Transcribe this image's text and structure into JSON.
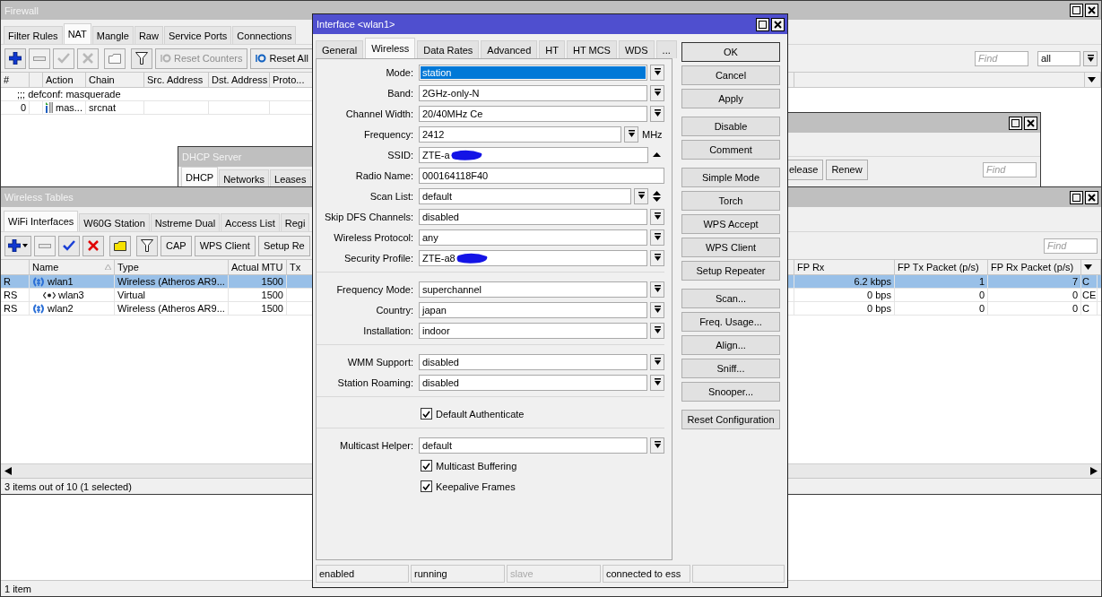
{
  "firewall": {
    "title": "Firewall",
    "tabs": [
      {
        "label": "Filter Rules",
        "selected": false
      },
      {
        "label": "NAT",
        "selected": true
      },
      {
        "label": "Mangle",
        "selected": false
      },
      {
        "label": "Raw",
        "selected": false
      },
      {
        "label": "Service Ports",
        "selected": false
      },
      {
        "label": "Connections",
        "selected": false
      }
    ],
    "toolbar": [
      {
        "kind": "add",
        "disabled": false
      },
      {
        "kind": "remove",
        "disabled": true
      },
      {
        "kind": "enable",
        "disabled": true
      },
      {
        "kind": "disable",
        "disabled": true
      },
      {
        "kind": "comment",
        "disabled": true
      },
      {
        "kind": "filter",
        "disabled": false
      },
      {
        "kind": "reset",
        "label": "Reset Counters",
        "disabled": true
      },
      {
        "kind": "reset",
        "label": "Reset All",
        "disabled": false
      }
    ],
    "find": {
      "placeholder": "Find"
    },
    "scope": "all",
    "columns": [
      "#",
      "Action",
      "Chain",
      "Src. Address",
      "Dst. Address",
      "Proto..."
    ],
    "rows": [
      {
        "kind": "comment",
        "text": ";;; defconf: masquerade"
      },
      {
        "kind": "rule",
        "number": "0",
        "action": "mas...",
        "chain": "srcnat"
      }
    ],
    "status": "1 item"
  },
  "dhcp_server": {
    "title": "DHCP Server",
    "tabs": [
      {
        "label": "DHCP",
        "selected": true
      },
      {
        "label": "Networks",
        "selected": false
      },
      {
        "label": "Leases",
        "selected": false
      }
    ]
  },
  "dhcp_client": {
    "buttons": [
      "elease",
      "Renew"
    ],
    "find": {
      "placeholder": "Find"
    }
  },
  "wireless_tables": {
    "title": "Wireless Tables",
    "tabs": [
      {
        "label": "WiFi Interfaces",
        "selected": true
      },
      {
        "label": "W60G Station",
        "selected": false
      },
      {
        "label": "Nstreme Dual",
        "selected": false
      },
      {
        "label": "Access List",
        "selected": false
      },
      {
        "label": "Regi",
        "selected": false
      }
    ],
    "toolbar": [
      {
        "kind": "add_menu",
        "disabled": false
      },
      {
        "kind": "remove",
        "disabled": true
      },
      {
        "kind": "enable",
        "disabled": false
      },
      {
        "kind": "disable",
        "disabled": false
      },
      {
        "kind": "comment",
        "disabled": false
      },
      {
        "kind": "filter",
        "disabled": false
      },
      {
        "kind": "text",
        "label": "CAP",
        "disabled": false
      },
      {
        "kind": "text",
        "label": "WPS Client",
        "disabled": false
      },
      {
        "kind": "text",
        "label": "Setup Re",
        "disabled": false
      }
    ],
    "find": {
      "placeholder": "Find"
    },
    "columns": [
      "Name",
      "Type",
      "Actual MTU",
      "Tx"
    ],
    "right_columns": [
      "FP Rx",
      "FP Tx Packet (p/s)",
      "FP Rx Packet (p/s)"
    ],
    "rows": [
      {
        "flags": "R",
        "name": "wlan1",
        "kind": "wireless",
        "type": "Wireless (Atheros AR9...",
        "mtu": "1500",
        "fp_rx": "6.2 kbps",
        "fp_tx_packet": "1",
        "fp_rx_packet": "7",
        "column_last": "C",
        "selected": true,
        "children": [
          {
            "flags": "RS",
            "name": "wlan3",
            "kind": "virtual",
            "type": "Virtual",
            "mtu": "1500",
            "fp_rx": "0 bps",
            "fp_tx_packet": "0",
            "fp_rx_packet": "0",
            "column_last": "CE",
            "selected": false
          }
        ]
      },
      {
        "flags": "RS",
        "name": "wlan2",
        "kind": "wireless",
        "type": "Wireless (Atheros AR9...",
        "mtu": "1500",
        "fp_rx": "0 bps",
        "fp_tx_packet": "0",
        "fp_rx_packet": "0",
        "column_last": "C",
        "selected": false
      }
    ],
    "status": "3 items out of 10 (1 selected)"
  },
  "interface_dialog": {
    "title": "Interface <wlan1>",
    "tabs": [
      {
        "label": "General",
        "selected": false
      },
      {
        "label": "Wireless",
        "selected": true
      },
      {
        "label": "Data Rates",
        "selected": false
      },
      {
        "label": "Advanced",
        "selected": false
      },
      {
        "label": "HT",
        "selected": false
      },
      {
        "label": "HT MCS",
        "selected": false
      },
      {
        "label": "WDS",
        "selected": false
      },
      {
        "label": "...",
        "selected": false
      }
    ],
    "fields": [
      {
        "kind": "combo",
        "label": "Mode:",
        "value": "station",
        "highlighted": true,
        "redacted": false
      },
      {
        "kind": "combo",
        "label": "Band:",
        "value": "2GHz-only-N",
        "highlighted": false,
        "redacted": false
      },
      {
        "kind": "combo",
        "label": "Channel Width:",
        "value": "20/40MHz Ce",
        "highlighted": false,
        "redacted": false
      },
      {
        "kind": "combo",
        "label": "Frequency:",
        "value": "2412",
        "unit": "MHz",
        "highlighted": false,
        "redacted": false
      },
      {
        "kind": "collapsible",
        "label": "SSID:",
        "value": "ZTE-a",
        "highlighted": false,
        "redacted": true
      },
      {
        "kind": "text",
        "label": "Radio Name:",
        "value": "000164118F40",
        "highlighted": false,
        "redacted": false
      },
      {
        "kind": "multiselect",
        "label": "Scan List:",
        "value": "default",
        "highlighted": false,
        "redacted": false
      },
      {
        "kind": "combo",
        "label": "Skip DFS Channels:",
        "value": "disabled",
        "highlighted": false,
        "redacted": false
      },
      {
        "kind": "combo",
        "label": "Wireless Protocol:",
        "value": "any",
        "highlighted": false,
        "redacted": false
      },
      {
        "kind": "combo",
        "label": "Security Profile:",
        "value": "ZTE-a8",
        "highlighted": false,
        "redacted": true
      },
      {
        "kind": "separator"
      },
      {
        "kind": "combo",
        "label": "Frequency Mode:",
        "value": "superchannel",
        "highlighted": false,
        "redacted": false
      },
      {
        "kind": "combo",
        "label": "Country:",
        "value": "japan",
        "highlighted": false,
        "redacted": false
      },
      {
        "kind": "combo",
        "label": "Installation:",
        "value": "indoor",
        "highlighted": false,
        "redacted": false
      },
      {
        "kind": "separator"
      },
      {
        "kind": "combo",
        "label": "WMM Support:",
        "value": "disabled",
        "highlighted": false,
        "redacted": false
      },
      {
        "kind": "combo",
        "label": "Station Roaming:",
        "value": "disabled",
        "highlighted": false,
        "redacted": false
      },
      {
        "kind": "separator"
      },
      {
        "kind": "checkbox",
        "label": "Default Authenticate",
        "checked": true
      },
      {
        "kind": "separator"
      },
      {
        "kind": "combo",
        "label": "Multicast Helper:",
        "value": "default",
        "highlighted": false,
        "redacted": false
      },
      {
        "kind": "checkbox",
        "label": "Multicast Buffering",
        "checked": true
      },
      {
        "kind": "checkbox",
        "label": "Keepalive Frames",
        "checked": true
      }
    ],
    "button_groups": [
      [
        {
          "label": "OK",
          "default": true
        },
        {
          "label": "Cancel",
          "default": false
        },
        {
          "label": "Apply",
          "default": false
        }
      ],
      [
        {
          "label": "Disable",
          "default": false
        },
        {
          "label": "Comment",
          "default": false
        }
      ],
      [
        {
          "label": "Simple Mode",
          "default": false
        },
        {
          "label": "Torch",
          "default": false
        },
        {
          "label": "WPS Accept",
          "default": false
        },
        {
          "label": "WPS Client",
          "default": false
        },
        {
          "label": "Setup Repeater",
          "default": false
        }
      ],
      [
        {
          "label": "Scan...",
          "default": false
        },
        {
          "label": "Freq. Usage...",
          "default": false
        },
        {
          "label": "Align...",
          "default": false
        },
        {
          "label": "Sniff...",
          "default": false
        },
        {
          "label": "Snooper...",
          "default": false
        }
      ],
      [
        {
          "label": "Reset Configuration",
          "default": false
        }
      ]
    ],
    "status": [
      {
        "text": "enabled",
        "disabled": false
      },
      {
        "text": "running",
        "disabled": false
      },
      {
        "text": "slave",
        "disabled": true
      },
      {
        "text": "connected to ess",
        "disabled": false
      }
    ]
  }
}
